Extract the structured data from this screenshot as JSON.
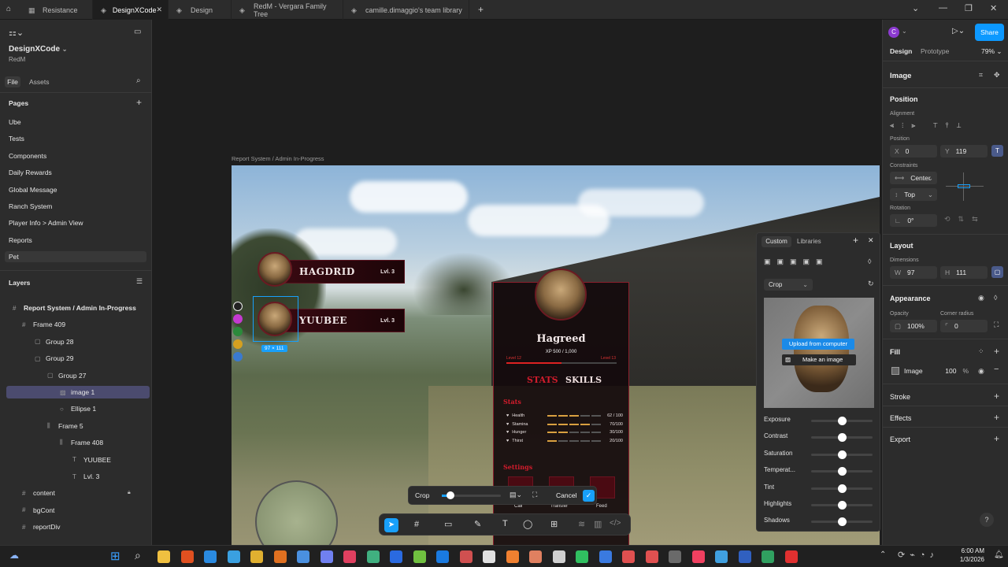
{
  "tabs": [
    {
      "label": "Resistance",
      "active": false
    },
    {
      "label": "DesignXCode",
      "active": true
    },
    {
      "label": "Design",
      "active": false
    },
    {
      "label": "RedM - Vergara Family Tree",
      "active": false
    },
    {
      "label": "camille.dimaggio's team library",
      "active": false
    }
  ],
  "file": {
    "name": "DesignXCode",
    "team": "RedM",
    "tab_file": "File",
    "tab_assets": "Assets"
  },
  "pages": {
    "title": "Pages",
    "items": [
      "Ube",
      "Tests",
      "Components",
      "Daily Rewards",
      "Global Message",
      "Ranch System",
      "Player Info > Admin View",
      "Reports",
      "Pet"
    ]
  },
  "layers": {
    "title": "Layers",
    "items": [
      {
        "label": "Report System / Admin In-Progress",
        "icon": "frame-icon"
      },
      {
        "label": "Frame 409",
        "icon": "frame-icon"
      },
      {
        "label": "Group 28",
        "icon": "group-icon"
      },
      {
        "label": "Group 29",
        "icon": "group-icon"
      },
      {
        "label": "Group 27",
        "icon": "group-icon"
      },
      {
        "label": "image 1",
        "icon": "image-icon"
      },
      {
        "label": "Ellipse 1",
        "icon": "ellipse-icon"
      },
      {
        "label": "Frame 5",
        "icon": "autolayout-icon"
      },
      {
        "label": "Frame 408",
        "icon": "autolayout-icon"
      },
      {
        "label": "YUUBEE",
        "icon": "text-icon"
      },
      {
        "label": "Lvl. 3",
        "icon": "text-icon"
      },
      {
        "label": "content",
        "icon": "frame-icon"
      },
      {
        "label": "bgCont",
        "icon": "frame-icon"
      },
      {
        "label": "reportDiv",
        "icon": "frame-icon"
      }
    ]
  },
  "canvas": {
    "frame_label": "Report System / Admin In-Progress",
    "selection_size": "97 × 111",
    "banner1_name": "HAGDRID",
    "banner1_lvl": "Lvl. 3",
    "banner2_name": "YUUBEE",
    "banner2_lvl": "Lvl. 3",
    "card_name": "Hagreed",
    "xp": "XP 500 / 1,000",
    "level_left": "Level 12",
    "level_right": "Level 13",
    "tab_stats": "STATS",
    "tab_skills": "SKILLS",
    "stats_title": "Stats",
    "stats": [
      {
        "label": "Health",
        "value": "62 / 100",
        "level": 0.62
      },
      {
        "label": "Stamina",
        "value": "70/100",
        "level": 0.7
      },
      {
        "label": "Hunger",
        "value": "30/100",
        "level": 0.3
      },
      {
        "label": "Thirst",
        "value": "20/100",
        "level": 0.2
      }
    ],
    "settings_title": "Settings",
    "bottom_labels": [
      "Call",
      "Transfer",
      "Feed"
    ]
  },
  "crop_toolbar": {
    "crop": "Crop",
    "cancel": "Cancel"
  },
  "image_popup": {
    "tab_custom": "Custom",
    "tab_libraries": "Libraries",
    "mode": "Crop",
    "upload": "Upload from computer",
    "make": "Make an image",
    "sliders": [
      {
        "label": "Exposure",
        "level": 0.5
      },
      {
        "label": "Contrast",
        "level": 0.5
      },
      {
        "label": "Saturation",
        "level": 0.5
      },
      {
        "label": "Temperat...",
        "level": 0.5
      },
      {
        "label": "Tint",
        "level": 0.5
      },
      {
        "label": "Highlights",
        "level": 0.5
      },
      {
        "label": "Shadows",
        "level": 0.5
      }
    ]
  },
  "right": {
    "avatar": "C",
    "share": "Share",
    "tab_design": "Design",
    "tab_prototype": "Prototype",
    "zoom": "79%",
    "selection": "Image",
    "position_title": "Position",
    "alignment": "Alignment",
    "position_label": "Position",
    "x_key": "X",
    "x": "0",
    "y_key": "Y",
    "y": "119",
    "constraints": "Constraints",
    "constraint_h": "Center",
    "constraint_v": "Top",
    "rotation": "Rotation",
    "rotation_val": "0°",
    "layout_title": "Layout",
    "dimensions": "Dimensions",
    "w_key": "W",
    "w": "97",
    "h_key": "H",
    "h": "111",
    "appearance_title": "Appearance",
    "opacity_label": "Opacity",
    "opacity": "100%",
    "radius_label": "Corner radius",
    "radius": "0",
    "fill_title": "Fill",
    "fill_type": "Image",
    "fill_opacity": "100",
    "fill_pct": "%",
    "stroke": "Stroke",
    "effects": "Effects",
    "export": "Export"
  },
  "taskbar": {
    "time": "6:00 AM",
    "date": "1/3/2026"
  }
}
